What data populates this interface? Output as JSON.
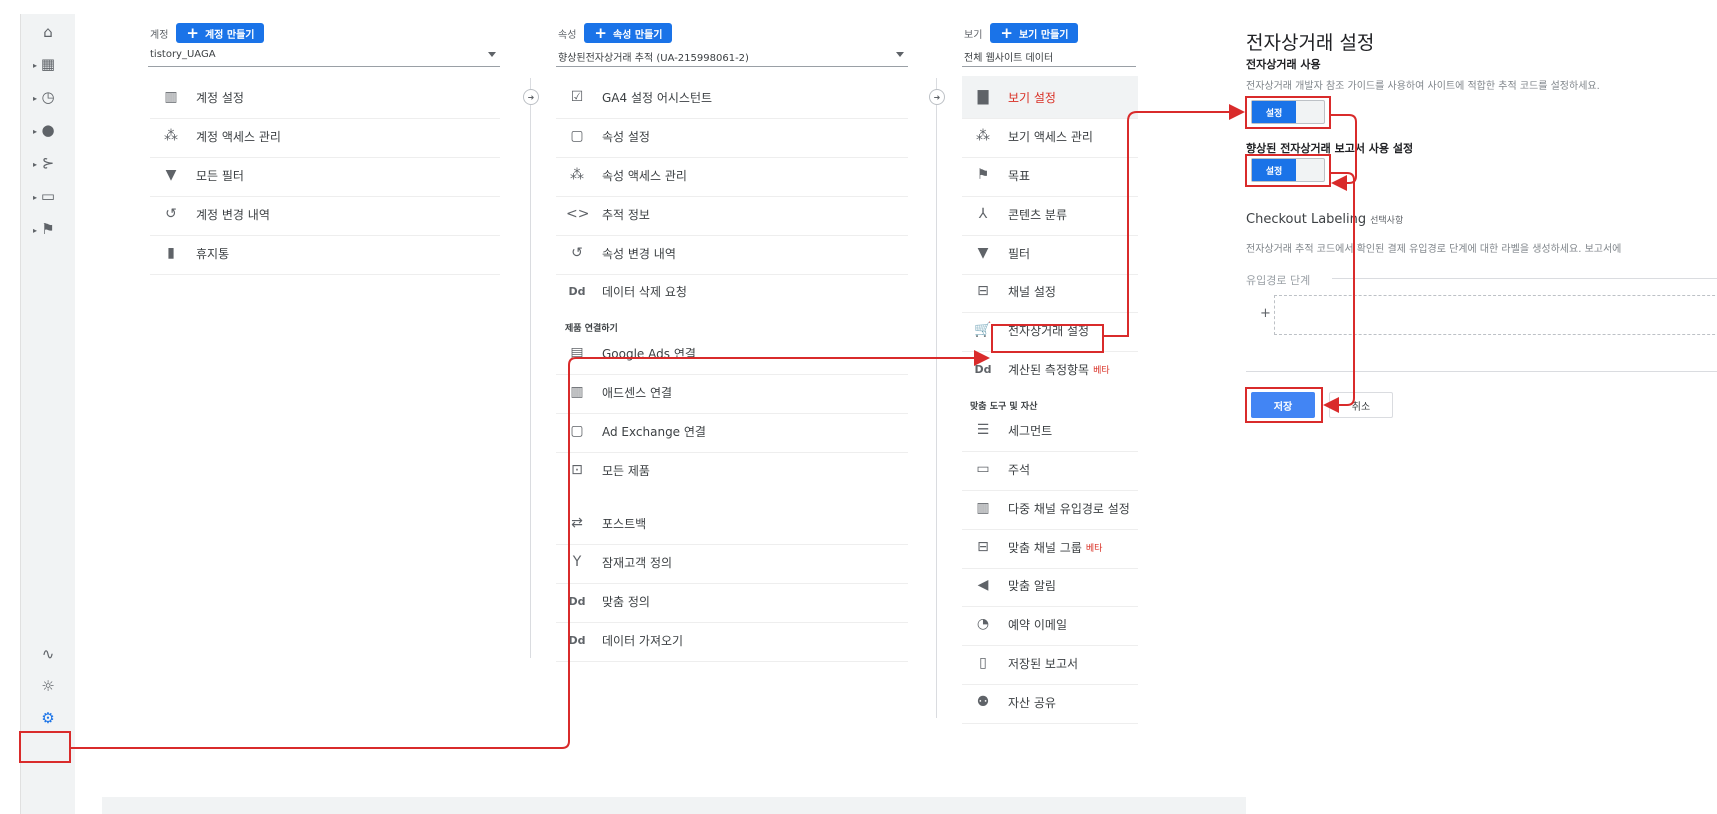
{
  "account": {
    "label": "계정",
    "create": "계정 만들기",
    "selected": "tistory_UAGA",
    "items": [
      "계정 설정",
      "계정 액세스 관리",
      "모든 필터",
      "계정 변경 내역",
      "휴지통"
    ]
  },
  "property": {
    "label": "속성",
    "create": "속성 만들기",
    "selected": "향상된전자상거래 추적 (UA-215998061-2)",
    "items": [
      "GA4 설정 어시스턴트",
      "속성 설정",
      "속성 액세스 관리",
      "추적 정보",
      "속성 변경 내역",
      "데이터 삭제 요청"
    ],
    "product_section": "제품 연결하기",
    "product_items": [
      "Google Ads 연결",
      "애드센스 연결",
      "Ad Exchange 연결",
      "모든 제품"
    ],
    "other_items": [
      "포스트백",
      "잠재고객 정의",
      "맞춤 정의",
      "데이터 가져오기"
    ]
  },
  "view": {
    "label": "보기",
    "create": "보기 만들기",
    "selected": "전체 웹사이트 데이터",
    "items": [
      "보기 설정",
      "보기 액세스 관리",
      "목표",
      "콘텐츠 분류",
      "필터",
      "채널 설정",
      "전자상거래 설정",
      "계산된 측정항목"
    ],
    "beta": "베타",
    "tools_section": "맞춤 도구 및 자산",
    "tools_items": [
      "세그먼트",
      "주석",
      "다중 채널 유입경로 설정",
      "맞춤 채널 그룹",
      "맞춤 알림",
      "예약 이메일",
      "저장된 보고서",
      "자산 공유"
    ]
  },
  "panel": {
    "title": "전자상거래 설정",
    "enable_heading": "전자상거래 사용",
    "enable_desc": "전자상거래 개발자 참조 가이드를 사용하여 사이트에 적합한 추적 코드를 설정하세요.",
    "toggle_on": "설정",
    "enhanced_heading": "향상된 전자상거래 보고서 사용 설정",
    "checkout_label": "Checkout Labeling",
    "checkout_optional": "선택사항",
    "checkout_desc": "전자상거래 추적 코드에서 확인된 결제 유입경로 단계에 대한 라벨을 생성하세요. 보고서에",
    "funnel_label": "유입경로 단계",
    "add": "+",
    "save": "저장",
    "cancel": "취소"
  },
  "icons": {
    "rail": [
      "home-icon",
      "dashboard-icon",
      "clock-icon",
      "person-icon",
      "acquisition-icon",
      "behavior-icon",
      "flag-icon",
      "path-icon",
      "lightbulb-icon",
      "gear-icon"
    ]
  },
  "colors": {
    "accent": "#1a73e8",
    "highlight": "#d92b2b",
    "selected_text": "#d93025"
  }
}
